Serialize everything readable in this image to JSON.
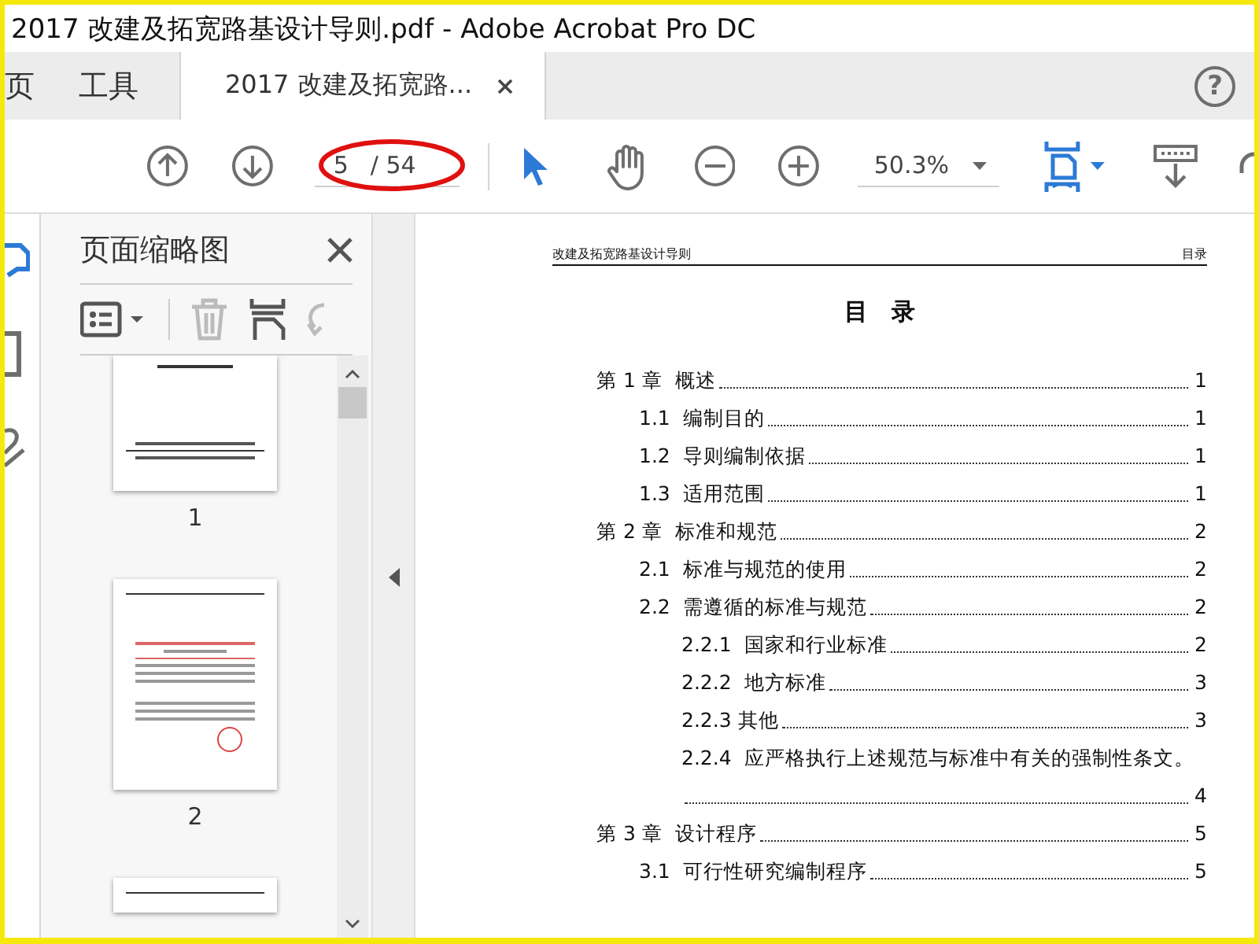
{
  "window": {
    "title": "2017 改建及拓宽路基设计导则.pdf - Adobe Acrobat Pro DC"
  },
  "tabs": [
    {
      "label": "页",
      "selected": false
    },
    {
      "label": "工具",
      "selected": false
    },
    {
      "label": "2017 改建及拓宽路...",
      "selected": true
    }
  ],
  "help": "?",
  "toolbar": {
    "page": "5",
    "page_total": "/ 54",
    "zoom": "50.3%",
    "tools": [
      {
        "kind": "select",
        "selected": true
      },
      {
        "kind": "hand",
        "selected": false
      }
    ]
  },
  "side_icons": [
    {
      "kind": "thumbnails",
      "selected": true
    },
    {
      "kind": "bookmark",
      "selected": false
    },
    {
      "kind": "sign",
      "selected": false
    }
  ],
  "thumbnail_panel": {
    "title": "页面缩略图",
    "pages": [
      {
        "label": "1",
        "kind": "cover"
      },
      {
        "label": "2",
        "kind": "letter"
      }
    ]
  },
  "document": {
    "header_left": "改建及拓宽路基设计导则",
    "header_right": "目录",
    "title": "目　录",
    "toc": [
      {
        "label": "第 1 章  概述",
        "page": "1",
        "children": [
          {
            "label": "1.1  编制目的",
            "page": "1"
          },
          {
            "label": "1.2  导则编制依据",
            "page": "1"
          },
          {
            "label": "1.3  适用范围",
            "page": "1"
          }
        ]
      },
      {
        "label": "第 2 章  标准和规范",
        "page": "2",
        "children": [
          {
            "label": "2.1  标准与规范的使用",
            "page": "2"
          },
          {
            "label": "2.2  需遵循的标准与规范",
            "page": "2",
            "children": [
              {
                "label": "2.2.1  国家和行业标准",
                "page": "2"
              },
              {
                "label": "2.2.2  地方标准",
                "page": "3"
              },
              {
                "label": "2.2.3 其他",
                "page": "3"
              },
              {
                "label": "2.2.4  应严格执行上述规范与标准中有关的强制性条文。",
                "page": "4"
              }
            ]
          }
        ]
      },
      {
        "label": "第 3 章  设计程序",
        "page": "5",
        "children": [
          {
            "label": "3.1  可行性研究编制程序",
            "page": "5"
          }
        ]
      }
    ]
  }
}
